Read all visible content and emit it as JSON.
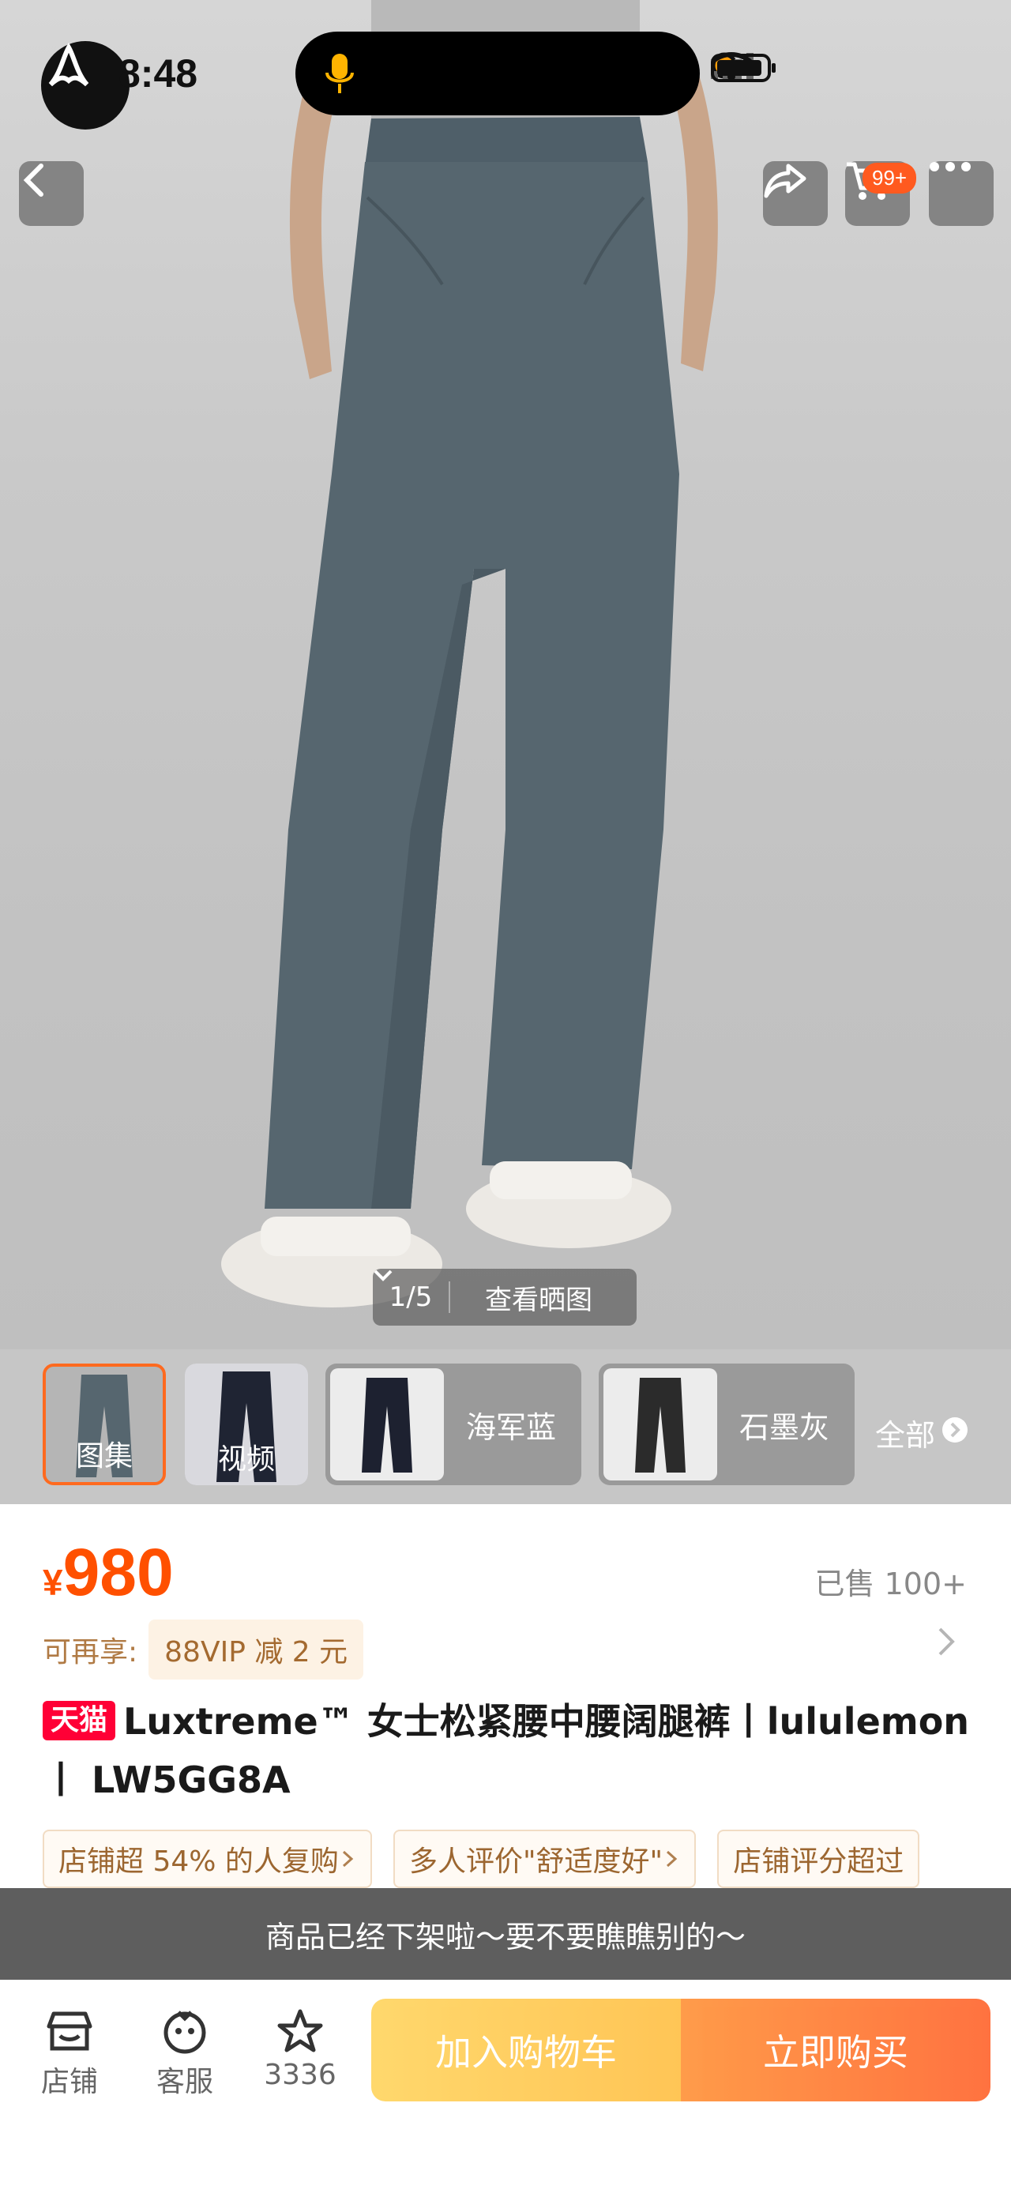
{
  "status_bar": {
    "time": "8:48"
  },
  "top_bar": {
    "cart_badge": "99+"
  },
  "gallery": {
    "counter": "1/5",
    "view_label": "查看晒图",
    "thumbs": [
      {
        "label": "图集",
        "active": true
      },
      {
        "label": "视频",
        "active": false
      }
    ],
    "colors": [
      {
        "label": "海军蓝"
      },
      {
        "label": "石墨灰"
      }
    ],
    "all_label": "全部"
  },
  "product": {
    "currency": "¥",
    "price": "980",
    "sold": "已售 100+",
    "vip_label": "可再享:",
    "vip_tag": "88VIP 减 2 元",
    "tmall_tag": "天猫",
    "title": "Luxtreme™ 女士松紧腰中腰阔腿裤丨lululemon 丨 LW5GG8A",
    "chips": [
      "店铺超 54% 的人复购",
      "多人评价\"舒适度好\"",
      "店铺评分超过"
    ]
  },
  "notice": "商品已经下架啦～要不要瞧瞧别的～",
  "bottom_bar": {
    "shop_label": "店铺",
    "service_label": "客服",
    "fav_count": "3336",
    "add_cart_label": "加入购物车",
    "buy_now_label": "立即购买"
  },
  "colors": {
    "price_orange": "#ff5000",
    "tmall_red": "#ff0036",
    "cta_yellow": "#ffb21e",
    "cta_orange": "#ff5a1f"
  }
}
